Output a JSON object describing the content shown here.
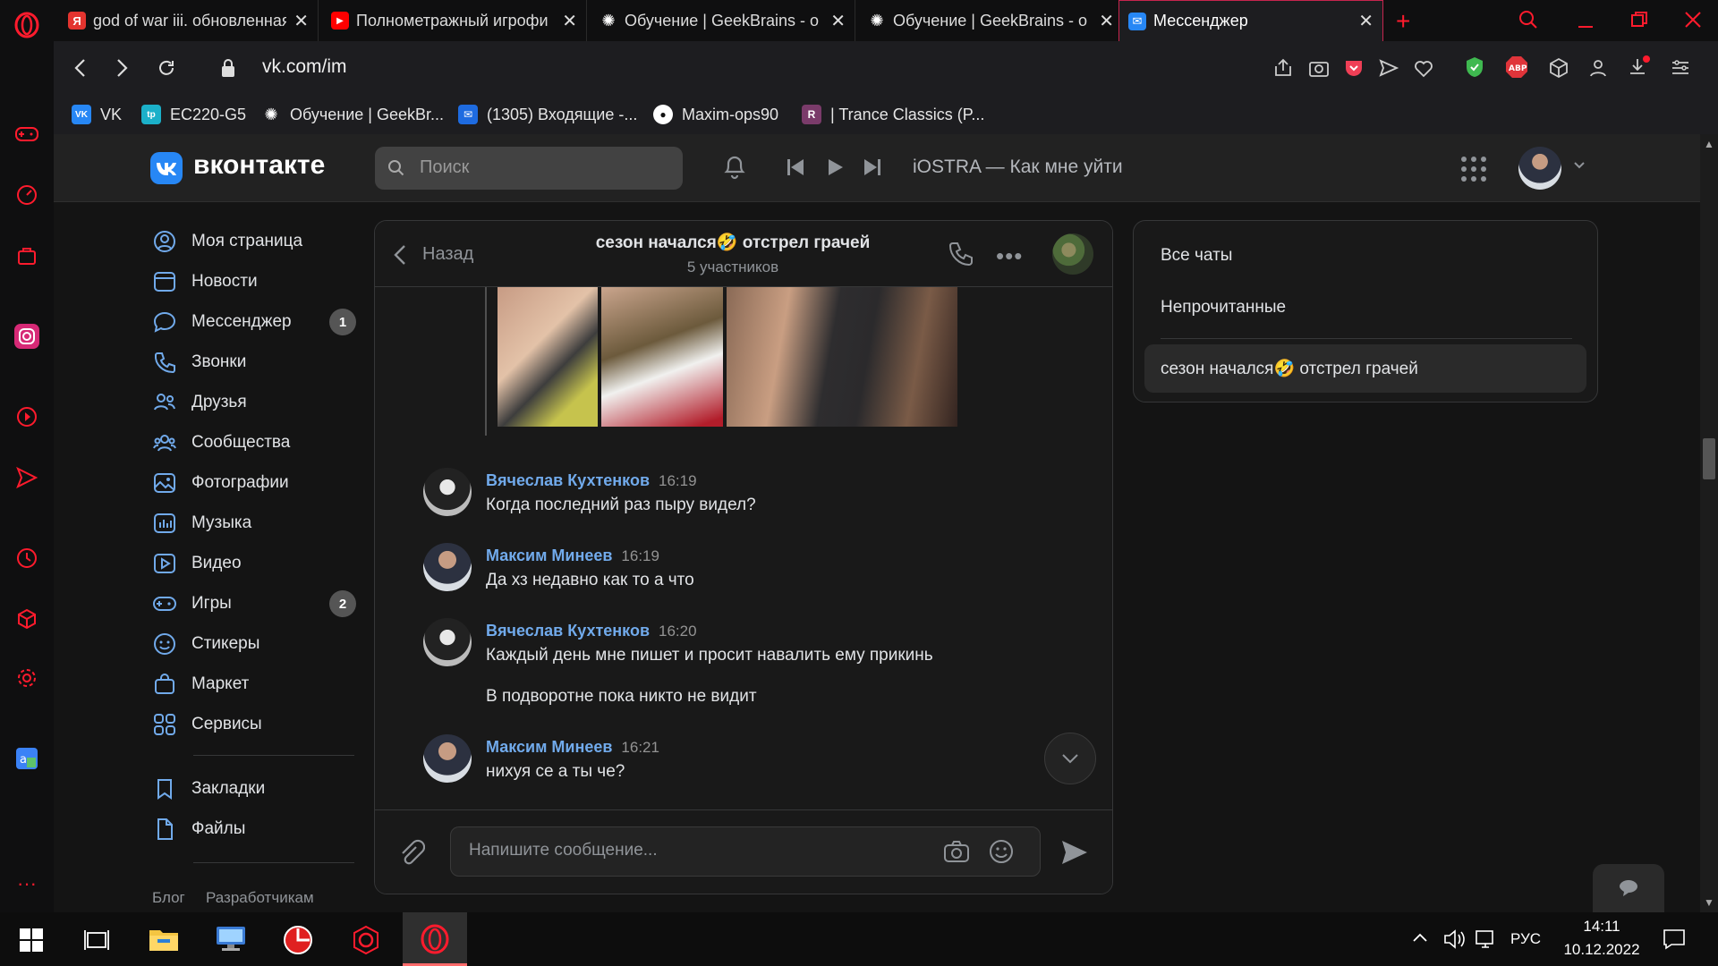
{
  "browser": {
    "tabs": [
      {
        "title": "god of war iii. обновленная",
        "favicon": "yandex",
        "color": "#e3342f",
        "glyph": "Я"
      },
      {
        "title": "Полнометражный игрофи",
        "favicon": "youtube",
        "color": "#ff0000",
        "glyph": "▶"
      },
      {
        "title": "Обучение | GeekBrains - о",
        "favicon": "geekbrains",
        "color": "#333",
        "glyph": "✺"
      },
      {
        "title": "Обучение | GeekBrains - о",
        "favicon": "geekbrains",
        "color": "#333",
        "glyph": "✺"
      },
      {
        "title": "Мессенджер",
        "favicon": "vk-messenger",
        "color": "#2787f5",
        "glyph": "✉",
        "active": true
      }
    ],
    "url": "vk.com/im",
    "bookmarks": [
      {
        "label": "VK",
        "color": "#2787f5",
        "glyph": "VK"
      },
      {
        "label": "EC220-G5",
        "color": "#1bb0c9",
        "glyph": "tp"
      },
      {
        "label": "Обучение | GeekBr...",
        "color": "#333",
        "glyph": "✺"
      },
      {
        "label": "(1305) Входящие -...",
        "color": "#1e6be0",
        "glyph": "✉"
      },
      {
        "label": "Maxim-ops90",
        "color": "#222",
        "glyph": "●"
      },
      {
        "label": "| Trance Classics (P...",
        "color": "#7a3b6a",
        "glyph": "R"
      }
    ]
  },
  "vk": {
    "logo_text": "вконтакте",
    "search_placeholder": "Поиск",
    "player_track": "iOSTRA — Как мне уйти",
    "nav": [
      {
        "label": "Моя страница",
        "icon": "user-circle-icon"
      },
      {
        "label": "Новости",
        "icon": "news-icon"
      },
      {
        "label": "Мессенджер",
        "icon": "message-icon",
        "badge": "1"
      },
      {
        "label": "Звонки",
        "icon": "phone-icon"
      },
      {
        "label": "Друзья",
        "icon": "friends-icon"
      },
      {
        "label": "Сообщества",
        "icon": "communities-icon"
      },
      {
        "label": "Фотографии",
        "icon": "photo-icon"
      },
      {
        "label": "Музыка",
        "icon": "music-icon"
      },
      {
        "label": "Видео",
        "icon": "video-icon"
      },
      {
        "label": "Игры",
        "icon": "gamepad-icon",
        "badge": "2"
      },
      {
        "label": "Стикеры",
        "icon": "smile-icon"
      },
      {
        "label": "Маркет",
        "icon": "bag-icon"
      },
      {
        "label": "Сервисы",
        "icon": "services-icon"
      }
    ],
    "nav_secondary": [
      {
        "label": "Закладки",
        "icon": "bookmark-icon"
      },
      {
        "label": "Файлы",
        "icon": "file-icon"
      }
    ],
    "footer_links": [
      "Блог",
      "Разработчикам"
    ],
    "chat": {
      "back_label": "Назад",
      "title": "сезон начался🤣 отстрел грачей",
      "subtitle": "5 участников",
      "messages": [
        {
          "author": "Вячеслав Кухтенков",
          "time": "16:19",
          "lines": [
            "Когда последний раз пыру видел?"
          ],
          "avatar": "sunglasses"
        },
        {
          "author": "Максим Минеев",
          "time": "16:19",
          "lines": [
            "Да хз недавно как то а что"
          ],
          "avatar": "man"
        },
        {
          "author": "Вячеслав Кухтенков",
          "time": "16:20",
          "lines": [
            "Каждый день мне пишет и просит навалить ему прикинь",
            "В подворотне пока никто не видит"
          ],
          "avatar": "sunglasses"
        },
        {
          "author": "Максим Минеев",
          "time": "16:21",
          "lines": [
            "нихуя се а ты че?"
          ],
          "avatar": "man"
        }
      ],
      "input_placeholder": "Напишите сообщение..."
    },
    "filters": {
      "all": "Все чаты",
      "unread": "Непрочитанные",
      "selected_chat": "сезон начался🤣 отстрел грачей"
    }
  },
  "taskbar": {
    "language": "РУС",
    "time": "14:11",
    "date": "10.12.2022"
  },
  "colors": {
    "vk_blue": "#2787f5",
    "link_blue": "#71aaeb",
    "opera_red": "#ff1b2d"
  }
}
